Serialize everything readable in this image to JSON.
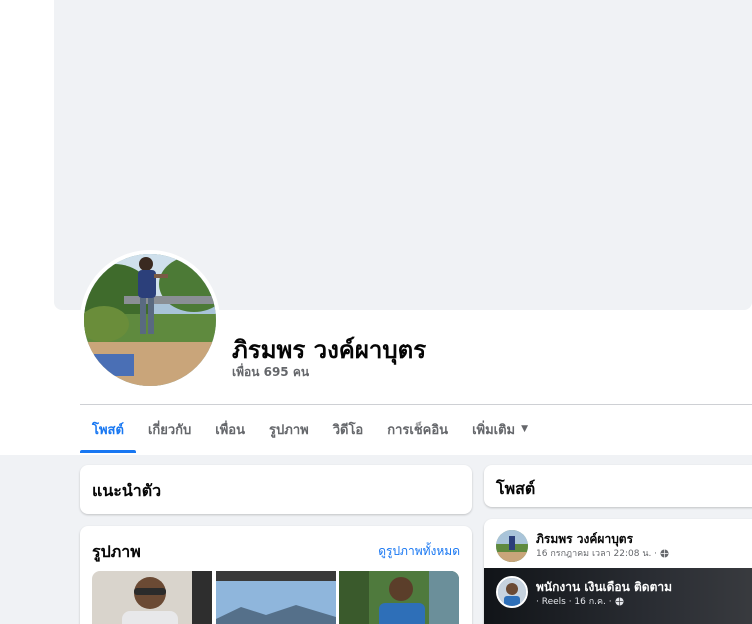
{
  "profile": {
    "name": "ภิรมพร วงค์ผาบุตร",
    "friends": "เพื่อน 695 คน"
  },
  "tabs": [
    {
      "label": "โพสต์",
      "active": true
    },
    {
      "label": "เกี่ยวกับ",
      "active": false
    },
    {
      "label": "เพื่อน",
      "active": false
    },
    {
      "label": "รูปภาพ",
      "active": false
    },
    {
      "label": "วิดีโอ",
      "active": false
    },
    {
      "label": "การเช็คอิน",
      "active": false
    },
    {
      "label": "เพิ่มเติม",
      "active": false
    }
  ],
  "intro": {
    "title": "แนะนำตัว"
  },
  "photos": {
    "title": "รูปภาพ",
    "see_all": "ดูรูปภาพทั้งหมด"
  },
  "posts": {
    "title": "โพสต์",
    "first_post": {
      "author": "ภิรมพร วงค์ผาบุตร",
      "meta": "16 กรกฎาคม เวลา 22:08 น. ·",
      "reel": {
        "title": "พนักงาน เงินเดือน ติดตาม",
        "meta": "· Reels · 16 ก.ค. ·"
      }
    }
  },
  "colors": {
    "accent": "#1877f2",
    "page_bg": "#f0f2f5",
    "secondary_text": "#65676b"
  },
  "icons": {
    "dropdown": "caret-down-icon",
    "audience": "globe-icon"
  }
}
